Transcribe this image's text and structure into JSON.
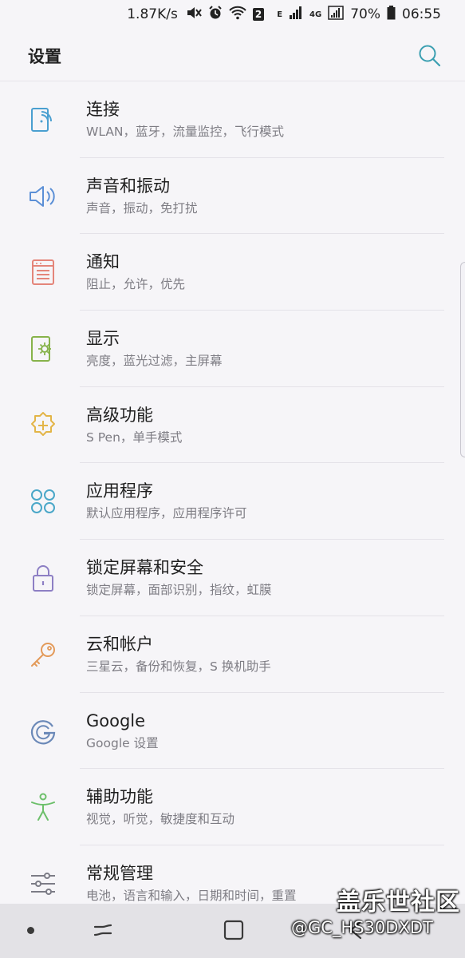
{
  "status_bar": {
    "speed": "1.87K/s",
    "sim_badge": "2",
    "network_e": "E",
    "network_4g": "4G",
    "battery": "70%",
    "time": "06:55"
  },
  "app_bar": {
    "title": "设置",
    "search_icon": "search-icon",
    "accent_color": "#3b9fb1"
  },
  "settings": [
    {
      "label": "连接",
      "sub": "WLAN，蓝牙，流量监控，飞行模式",
      "icon": "connection-icon",
      "color": "#4a9fd0"
    },
    {
      "label": "声音和振动",
      "sub": "声音，振动，免打扰",
      "icon": "speaker-icon",
      "color": "#5b8fd6"
    },
    {
      "label": "通知",
      "sub": "阻止，允许，优先",
      "icon": "notification-icon",
      "color": "#e4857a"
    },
    {
      "label": "显示",
      "sub": "亮度，蓝光过滤，主屏幕",
      "icon": "display-icon",
      "color": "#87b34b"
    },
    {
      "label": "高级功能",
      "sub": "S Pen，单手模式",
      "icon": "advanced-gear-icon",
      "color": "#e3b548"
    },
    {
      "label": "应用程序",
      "sub": "默认应用程序，应用程序许可",
      "icon": "apps-icon",
      "color": "#4aa7c8"
    },
    {
      "label": "锁定屏幕和安全",
      "sub": "锁定屏幕，面部识别，指纹，虹膜",
      "icon": "lock-icon",
      "color": "#8d7fc4"
    },
    {
      "label": "云和帐户",
      "sub": "三星云，备份和恢复，S 换机助手",
      "icon": "key-icon",
      "color": "#e39a5a"
    },
    {
      "label": "Google",
      "sub": "Google 设置",
      "icon": "google-icon",
      "color": "#6b89b8"
    },
    {
      "label": "辅助功能",
      "sub": "视觉，听觉，敏捷度和互动",
      "icon": "accessibility-icon",
      "color": "#6cbf6a"
    },
    {
      "label": "常规管理",
      "sub": "电池，语言和输入，日期和时间，重置",
      "icon": "sliders-icon",
      "color": "#7c7c86"
    }
  ],
  "watermark": {
    "brand": "盖乐世社区",
    "user": "@GC_HS30DXDT"
  }
}
